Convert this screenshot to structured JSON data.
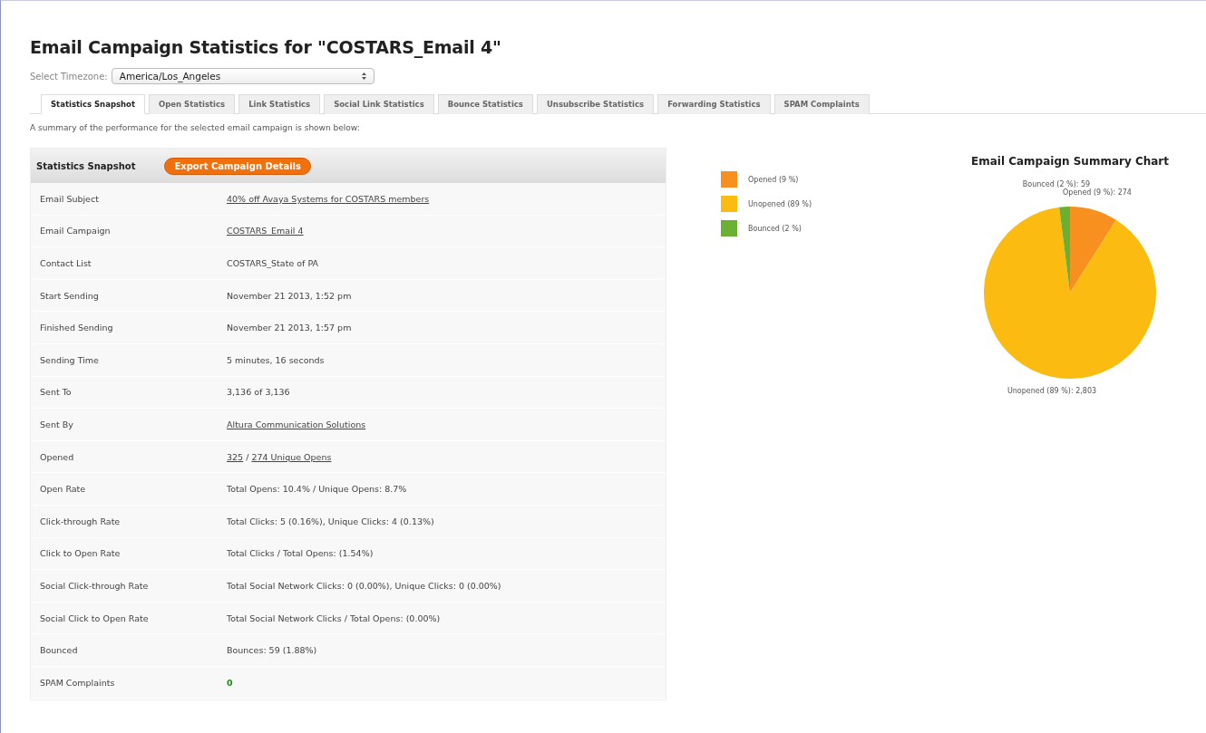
{
  "title": "Email Campaign Statistics for \"COSTARS_Email 4\"",
  "timezone": {
    "label": "Select Timezone:",
    "value": "America/Los_Angeles"
  },
  "tabs": [
    {
      "label": "Statistics Snapshot",
      "selected": true
    },
    {
      "label": "Open Statistics",
      "selected": false
    },
    {
      "label": "Link Statistics",
      "selected": false
    },
    {
      "label": "Social Link Statistics",
      "selected": false
    },
    {
      "label": "Bounce Statistics",
      "selected": false
    },
    {
      "label": "Unsubscribe Statistics",
      "selected": false
    },
    {
      "label": "Forwarding Statistics",
      "selected": false
    },
    {
      "label": "SPAM Complaints",
      "selected": false
    }
  ],
  "summary": "A summary of the performance for the selected email campaign is shown below:",
  "snapshot": {
    "heading": "Statistics Snapshot",
    "export_button": "Export Campaign Details",
    "rows": [
      {
        "label": "Email Subject",
        "kind": "plain",
        "parts": [
          {
            "text": "40% off Avaya Systems for COSTARS members",
            "link": true
          }
        ]
      },
      {
        "label": "Email Campaign",
        "kind": "plain",
        "parts": [
          {
            "text": "COSTARS_Email 4",
            "link": true
          }
        ]
      },
      {
        "label": "Contact List",
        "kind": "plain",
        "parts": [
          {
            "text": "COSTARS_State of PA",
            "link": false
          }
        ]
      },
      {
        "label": "Start Sending",
        "kind": "plain",
        "parts": [
          {
            "text": "November 21 2013, 1:52 pm",
            "link": false
          }
        ]
      },
      {
        "label": "Finished Sending",
        "kind": "plain",
        "parts": [
          {
            "text": "November 21 2013, 1:57 pm",
            "link": false
          }
        ]
      },
      {
        "label": "Sending Time",
        "kind": "plain",
        "parts": [
          {
            "text": "5 minutes, 16 seconds",
            "link": false
          }
        ]
      },
      {
        "label": "Sent To",
        "kind": "plain",
        "parts": [
          {
            "text": "3,136 of 3,136",
            "link": false
          }
        ]
      },
      {
        "label": "Sent By",
        "kind": "plain",
        "parts": [
          {
            "text": "Altura Communication Solutions",
            "link": true
          }
        ]
      },
      {
        "label": "Opened",
        "kind": "plain",
        "parts": [
          {
            "text": "325",
            "link": true
          },
          {
            "text": " / ",
            "link": false
          },
          {
            "text": "274 Unique Opens",
            "link": true
          }
        ]
      },
      {
        "label": "Open Rate",
        "kind": "plain",
        "parts": [
          {
            "text": "Total Opens: 10.4% / Unique Opens: 8.7%",
            "link": false
          }
        ]
      },
      {
        "label": "Click-through Rate",
        "kind": "plain",
        "parts": [
          {
            "text": "Total Clicks: 5 (0.16%), Unique Clicks: 4 (0.13%)",
            "link": false
          }
        ]
      },
      {
        "label": "Click to Open Rate",
        "kind": "plain",
        "parts": [
          {
            "text": "Total Clicks / Total Opens: (1.54%)",
            "link": false
          }
        ]
      },
      {
        "label": "Social Click-through Rate",
        "kind": "plain",
        "parts": [
          {
            "text": "Total Social Network Clicks: 0 (0.00%), Unique Clicks: 0 (0.00%)",
            "link": false
          }
        ]
      },
      {
        "label": "Social Click to Open Rate",
        "kind": "plain",
        "parts": [
          {
            "text": "Total Social Network Clicks / Total Opens: (0.00%)",
            "link": false
          }
        ]
      },
      {
        "label": "Bounced",
        "kind": "plain",
        "parts": [
          {
            "text": "Bounces: 59 (1.88%)",
            "link": false
          }
        ]
      },
      {
        "label": "SPAM Complaints",
        "kind": "count",
        "parts": [
          {
            "text": "0",
            "link": false
          }
        ]
      }
    ]
  },
  "chart": {
    "chart_data": {
      "type": "pie",
      "title": "Email Campaign Summary Chart",
      "categories": [
        "Opened (9 %)",
        "Unopened (89 %)",
        "Bounced (2 %)"
      ],
      "legend": true,
      "series": [
        {
          "colors": [
            "#f7901e",
            "#fbbb10",
            "#6cb033"
          ],
          "values": [
            9,
            89,
            2
          ]
        }
      ],
      "value_labels": [
        "Opened (9 %): 274",
        "Unopened (89 %): 2,803",
        "Bounced (2 %): 59"
      ]
    }
  }
}
